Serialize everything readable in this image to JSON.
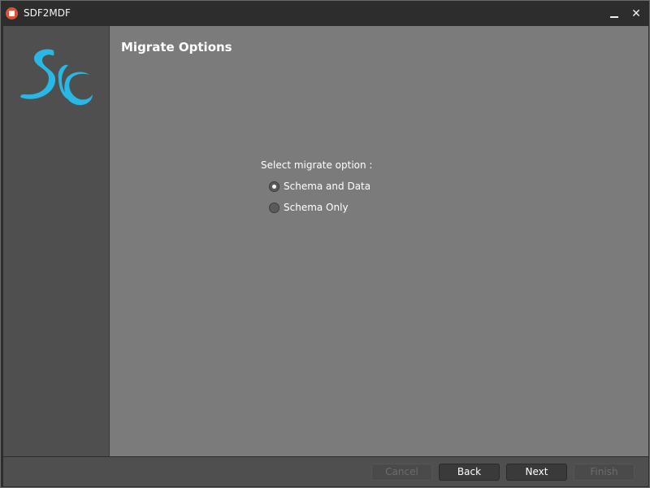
{
  "window": {
    "title": "SDF2MDF",
    "minimize_icon": "minimize-icon",
    "close_icon": "close-icon",
    "close_label": "✕"
  },
  "sidebar": {
    "logo_icon": "sc-logo-icon",
    "logo_color": "#29b8e6"
  },
  "main": {
    "title": "Migrate Options",
    "prompt": "Select migrate option :",
    "options": [
      {
        "label": "Schema and Data",
        "checked": true
      },
      {
        "label": "Schema Only",
        "checked": false
      }
    ]
  },
  "footer": {
    "cancel_label": "Cancel",
    "back_label": "Back",
    "next_label": "Next",
    "finish_label": "Finish"
  }
}
